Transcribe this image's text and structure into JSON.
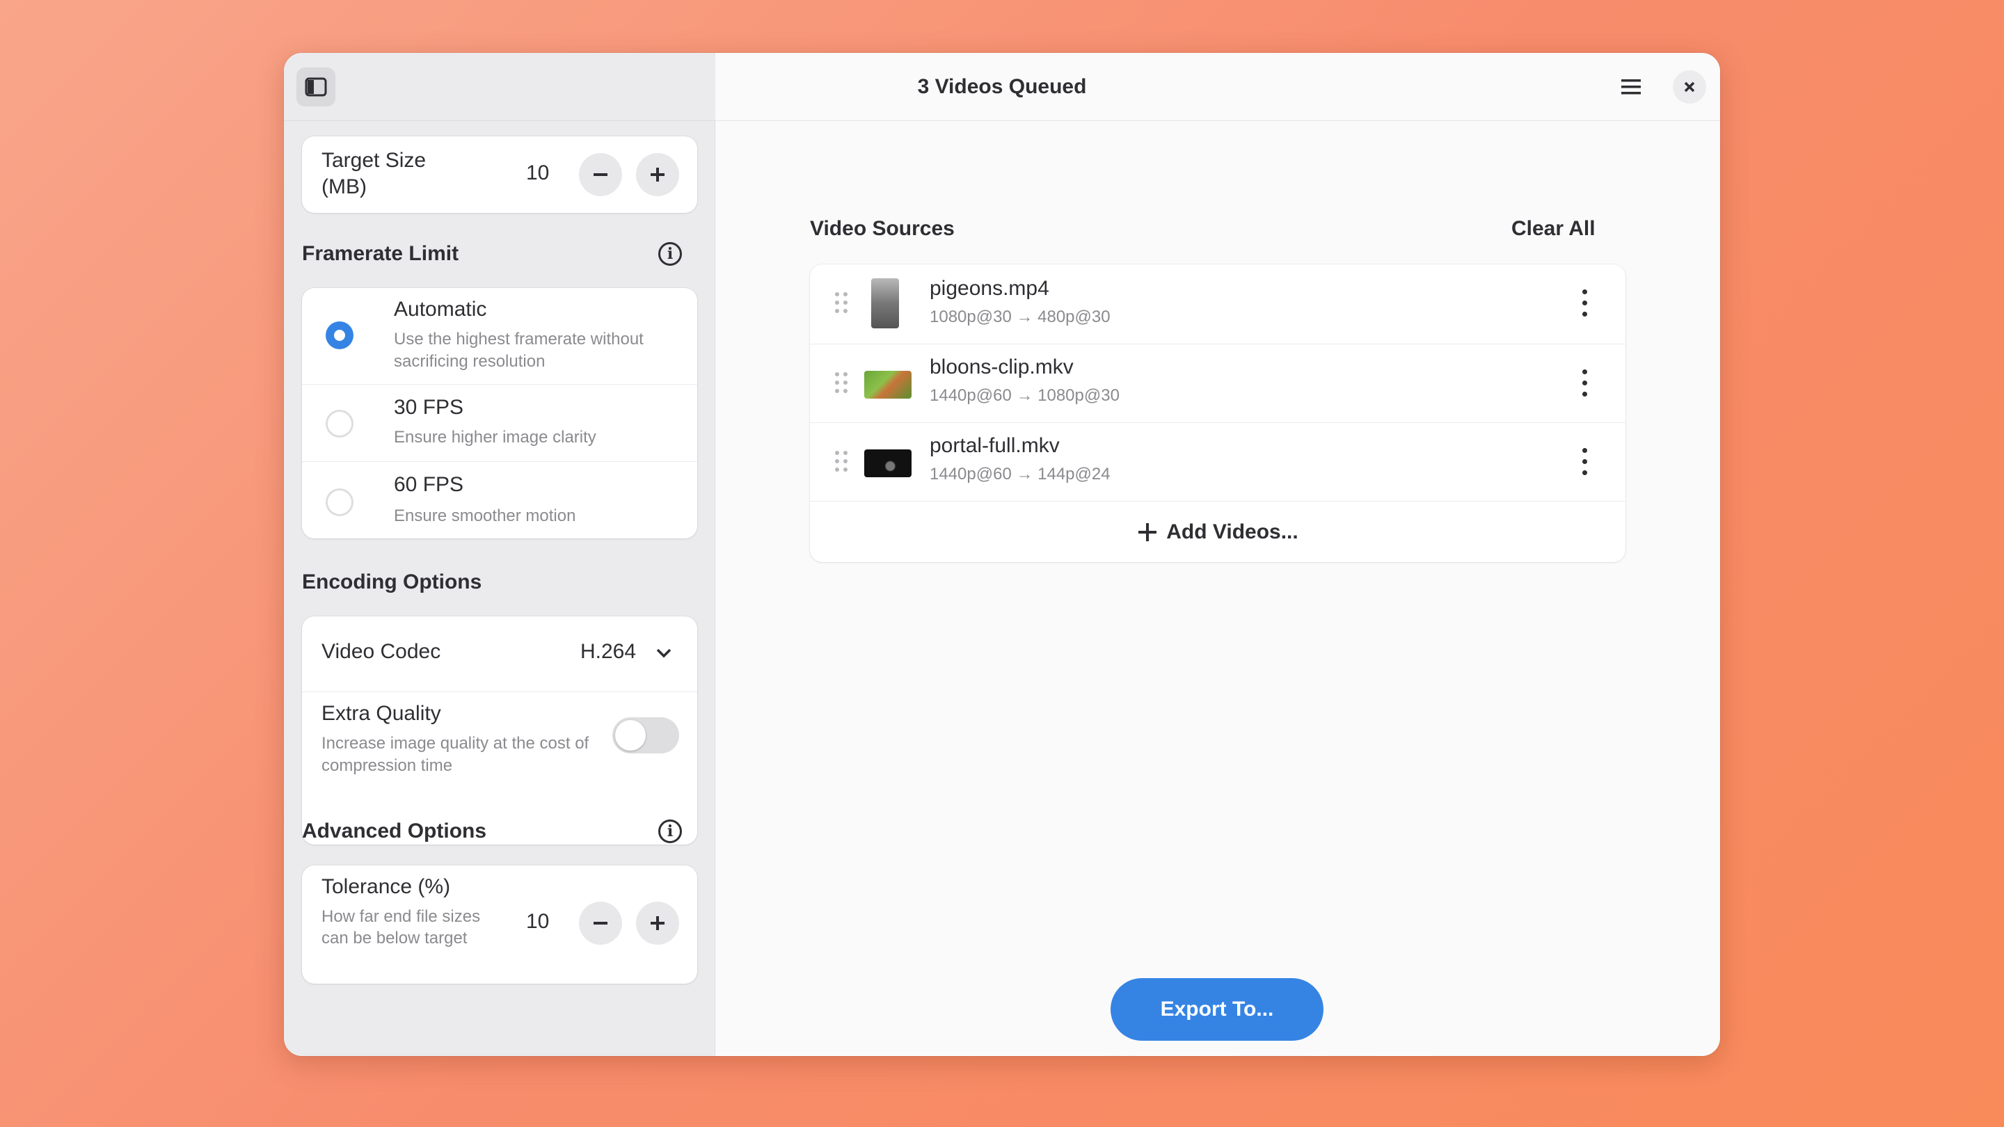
{
  "window": {
    "title": "3 Videos Queued"
  },
  "sidebar": {
    "target_size": {
      "label": "Target Size (MB)",
      "value": "10"
    },
    "framerate": {
      "title": "Framerate Limit",
      "options": [
        {
          "label": "Automatic",
          "description": "Use the highest framerate without sacrificing resolution",
          "selected": true
        },
        {
          "label": "30 FPS",
          "description": "Ensure higher image clarity",
          "selected": false
        },
        {
          "label": "60 FPS",
          "description": "Ensure smoother motion",
          "selected": false
        }
      ]
    },
    "encoding": {
      "title": "Encoding Options",
      "codec_label": "Video Codec",
      "codec_value": "H.264",
      "extra_quality_label": "Extra Quality",
      "extra_quality_description": "Increase image quality at the cost of compression time",
      "extra_quality_enabled": false
    },
    "advanced": {
      "title": "Advanced Options",
      "tolerance_label": "Tolerance (%)",
      "tolerance_description": "How far end file sizes can be below target",
      "tolerance_value": "10"
    }
  },
  "main": {
    "sources_title": "Video Sources",
    "clear_all": "Clear All",
    "videos": [
      {
        "name": "pigeons.mp4",
        "conversion": "1080p@30 → 480p@30"
      },
      {
        "name": "bloons-clip.mkv",
        "conversion": "1440p@60 → 1080p@30"
      },
      {
        "name": "portal-full.mkv",
        "conversion": "1440p@60 → 144p@24"
      }
    ],
    "add_videos": "Add Videos...",
    "export": "Export To..."
  },
  "colors": {
    "accent": "#3584e4",
    "background_gradient": [
      "#f9a58a",
      "#f98a5a"
    ]
  },
  "icons": [
    "sidebar-toggle-icon",
    "hamburger-menu-icon",
    "close-icon",
    "minus-icon",
    "plus-icon",
    "info-icon",
    "chevron-down-icon",
    "drag-handle-icon",
    "kebab-menu-icon"
  ]
}
